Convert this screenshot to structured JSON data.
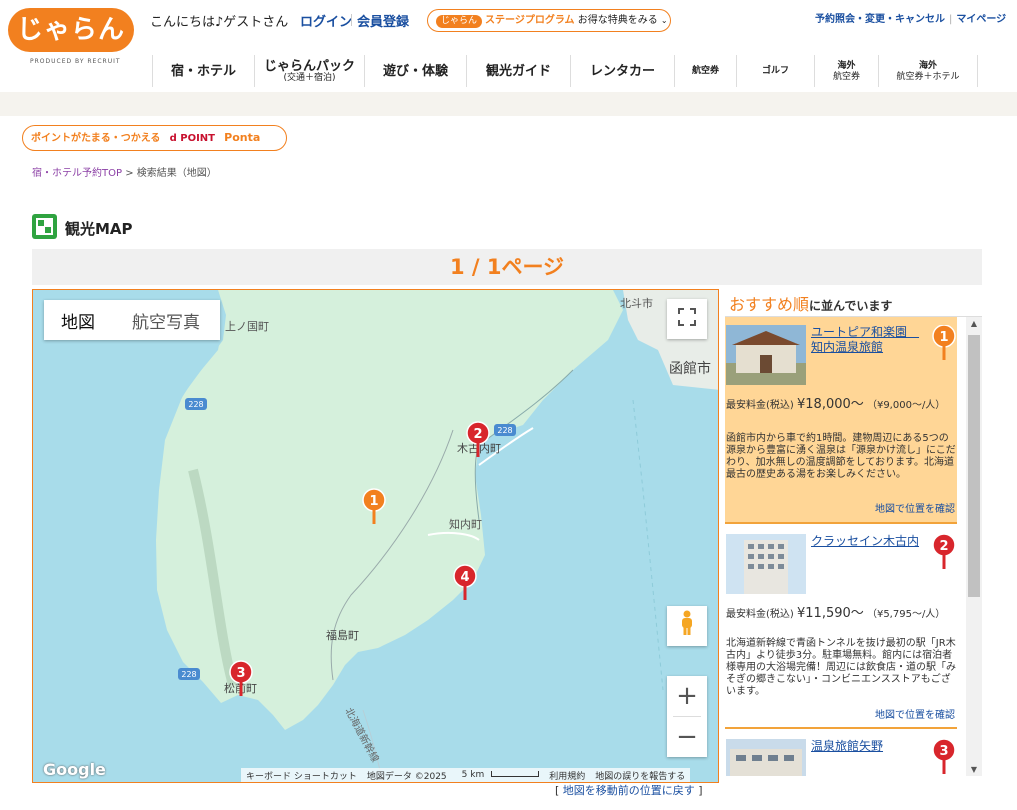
{
  "header": {
    "logo_text": "じゃらん",
    "logo_sub": "PRODUCED BY RECRUIT",
    "greeting": "こんにちは♪ゲストさん",
    "login": "ログイン",
    "register": "会員登録",
    "stage_logo": "じゃらん",
    "stage_title": "ステージプログラム",
    "stage_suffix": "お得な特典をみる",
    "top_link_1": "予約照会・変更・キャンセル",
    "top_link_2": "マイページ"
  },
  "nav": {
    "items": [
      {
        "label": "宿・ホテル",
        "sub": ""
      },
      {
        "label": "じゃらんパック",
        "sub": "(交通＋宿泊)"
      },
      {
        "label": "遊び・体験",
        "sub": ""
      },
      {
        "label": "観光ガイド",
        "sub": ""
      },
      {
        "label": "レンタカー",
        "sub": ""
      },
      {
        "label": "航空券",
        "sub": ""
      },
      {
        "label": "ゴルフ",
        "sub": ""
      },
      {
        "label": "海外",
        "sub": "航空券"
      },
      {
        "label": "海外",
        "sub": "航空券＋ホテル"
      }
    ]
  },
  "points": {
    "text": "ポイントがたまる・つかえる",
    "dpoint": "d POINT",
    "ponta": "Ponta"
  },
  "breadcrumb": {
    "top": "宿・ホテル予約TOP",
    "sep": ">",
    "current": "検索結果（地図）"
  },
  "page_title": "観光MAP",
  "pagination": "1 / 1ページ",
  "map": {
    "type_map": "地図",
    "type_aerial": "航空写真",
    "zoom_in": "+",
    "zoom_out": "−",
    "google": "Google",
    "attr_keyboard": "キーボード ショートカット",
    "attr_data": "地図データ ©2025",
    "attr_scale": "5 km",
    "attr_terms": "利用規約",
    "attr_report": "地図の誤りを報告する",
    "places": {
      "kaminokuni": "上ノ国町",
      "hokuto": "北斗市",
      "hakodate": "函館市",
      "kikonai": "木古内町",
      "shiriuchi": "知内町",
      "fukushima": "福島町",
      "matsumae": "松前町",
      "shinkansen": "北海道新幹線",
      "route_228a": "228",
      "route_228b": "228",
      "route_228c": "228"
    },
    "pins": [
      {
        "label": "1",
        "color": "#f2801f"
      },
      {
        "label": "2",
        "color": "#d8262c"
      },
      {
        "label": "3",
        "color": "#d8262c"
      },
      {
        "label": "4",
        "color": "#d8262c"
      }
    ],
    "back_link_open": "[",
    "back_link": "地図を移動前の位置に戻す",
    "back_link_close": "]"
  },
  "list": {
    "heading_strong": "おすすめ順",
    "heading_rest": "に並んでいます",
    "hotels": [
      {
        "rank": "1",
        "name": "ユートピア和楽園　知内温泉旅館",
        "price_label": "最安料金(税込)",
        "price": "¥18,000〜",
        "per_person": "（¥9,000〜/人）",
        "desc": "函館市内から車で約1時間。建物周辺にある5つの源泉から豊富に湧く温泉は「源泉かけ流し」にこだわり、加水無しの温度調節をしております。北海道最古の歴史ある湯をお楽しみください。",
        "locate": "地図で位置を確認"
      },
      {
        "rank": "2",
        "name": "クラッセイン木古内",
        "price_label": "最安料金(税込)",
        "price": "¥11,590〜",
        "per_person": "（¥5,795〜/人）",
        "desc": "北海道新幹線で青函トンネルを抜け最初の駅「JR木古内」より徒歩3分。駐車場無料。館内には宿泊者様専用の大浴場完備！周辺には飲食店・道の駅「みそぎの郷きこない」・コンビニエンスストアもございます。",
        "locate": "地図で位置を確認"
      },
      {
        "rank": "3",
        "name": "温泉旅館矢野",
        "price_label": "",
        "price": "",
        "per_person": "",
        "desc": "",
        "locate": ""
      }
    ]
  },
  "colors": {
    "brand_orange": "#f2801f",
    "pin_red": "#d8262c",
    "link_blue": "#1a4fa0",
    "land": "#d5f0dc",
    "sea": "#a8dcea"
  }
}
